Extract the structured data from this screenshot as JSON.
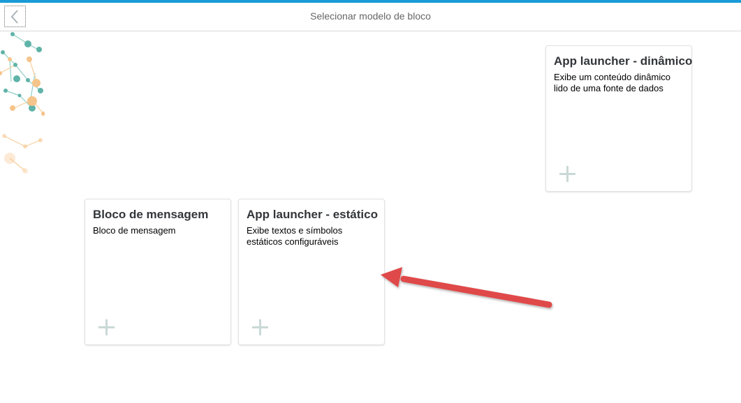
{
  "header": {
    "title": "Selecionar modelo de bloco",
    "back_icon": "chevron-left-icon"
  },
  "tiles": [
    {
      "title": "App launcher - dinâmico",
      "description": "Exibe um conteúdo dinâmico lido de uma fonte de dados",
      "add_icon": "plus-icon"
    },
    {
      "title": "Bloco de mensagem",
      "description": "Bloco de mensagem",
      "add_icon": "plus-icon"
    },
    {
      "title": "App launcher - estático",
      "description": "Exibe textos e símbolos estáticos configuráveis",
      "add_icon": "plus-icon"
    }
  ],
  "colors": {
    "accent_bar": "#1a9bd7",
    "annotation_arrow": "#e04848",
    "decor_teal": "#5fb3a8",
    "decor_orange": "#f5c48a"
  }
}
